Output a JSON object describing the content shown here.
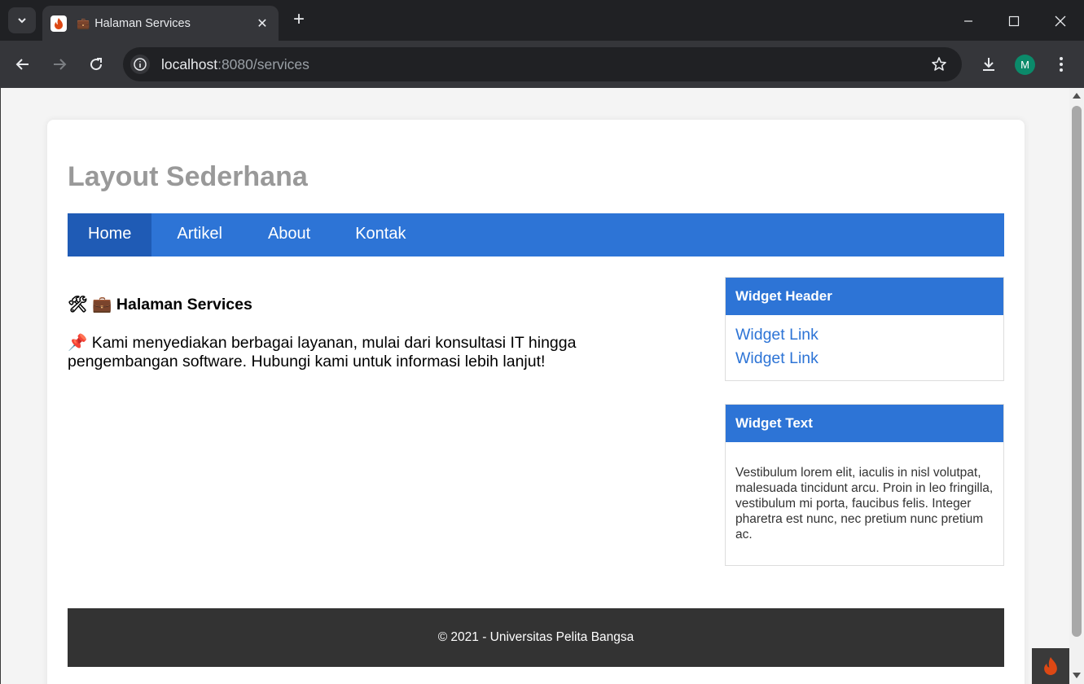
{
  "browser": {
    "tab": {
      "emoji": "💼",
      "title": "Halaman Services",
      "close_icon": "close-icon"
    },
    "url": {
      "host": "localhost",
      "path": ":8080/services"
    },
    "profile_initial": "M",
    "colors": {
      "frame": "#202124",
      "toolbar": "#35363a",
      "avatar": "#0b8a6a"
    }
  },
  "page": {
    "site_title": "Layout Sederhana",
    "nav": [
      {
        "label": "Home",
        "active": true
      },
      {
        "label": "Artikel",
        "active": false
      },
      {
        "label": "About",
        "active": false
      },
      {
        "label": "Kontak",
        "active": false
      }
    ],
    "content": {
      "heading_icons": "🛠 💼",
      "heading": "Halaman Services",
      "paragraph_icon": "📌",
      "paragraph": "Kami menyediakan berbagai layanan, mulai dari konsultasi IT hingga pengembangan software. Hubungi kami untuk informasi lebih lanjut!"
    },
    "widgets": {
      "links": {
        "header": "Widget Header",
        "items": [
          "Widget Link",
          "Widget Link"
        ]
      },
      "text": {
        "header": "Widget Text",
        "body": "Vestibulum lorem elit, iaculis in nisl volutpat, malesuada tincidunt arcu. Proin in leo fringilla, vestibulum mi porta, faucibus felis. Integer pharetra est nunc, nec pretium nunc pretium ac."
      }
    },
    "footer": "© 2021 - Universitas Pelita Bangsa",
    "colors": {
      "accent": "#2d74d6",
      "accent_active": "#1f5bb5",
      "title_gray": "#999999",
      "footer_bg": "#333333"
    }
  }
}
